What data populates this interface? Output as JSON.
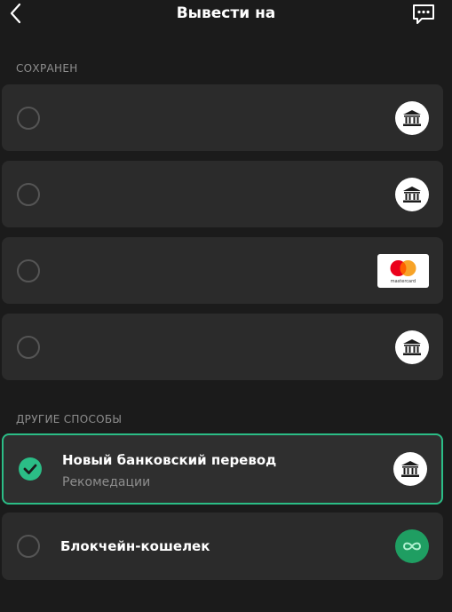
{
  "header": {
    "title": "Вывести на",
    "back_icon": "chevron-left-icon",
    "chat_icon": "chat-bubble-icon"
  },
  "saved": {
    "label": "СОХРАНЕН",
    "items": [
      {
        "icon": "bank-icon",
        "selected": false
      },
      {
        "icon": "bank-icon",
        "selected": false
      },
      {
        "icon": "mastercard-logo",
        "logo_caption": "mastercard",
        "selected": false
      },
      {
        "icon": "bank-icon",
        "selected": false
      }
    ]
  },
  "other": {
    "label": "ДРУГИЕ СПОСОБЫ",
    "items": [
      {
        "title": "Новый банковский перевод",
        "subtitle": "Рекомедации",
        "icon": "bank-icon",
        "selected": true
      },
      {
        "title": "Блокчейн-кошелек",
        "icon": "infinity-icon",
        "selected": false
      }
    ]
  },
  "colors": {
    "background": "#1b1b1b",
    "card": "#2b2b2b",
    "accent": "#2bbd86",
    "muted_text": "#8e8e8e",
    "mastercard_red": "#eb001b",
    "mastercard_orange": "#f79e1b"
  }
}
